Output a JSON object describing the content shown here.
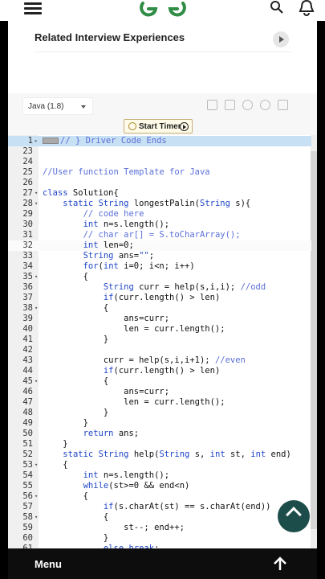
{
  "header": {
    "menu_icon": "hamburger-menu-icon",
    "logo": "geeksforgeeks-logo",
    "search_icon": "search-icon",
    "bell_icon": "notification-bell-icon"
  },
  "related": {
    "title": "Related Interview Experiences",
    "button_icon": "chevron-right-icon"
  },
  "editor": {
    "language": "Java (1.8)",
    "toolbar_icons": [
      "copy-icon",
      "export-icon",
      "settings-icon",
      "reset-icon",
      "fullscreen-icon"
    ],
    "timer_label": "Start Timer",
    "code_lines": [
      {
        "n": "1",
        "fold": "▸",
        "text": "// } Driver Code Ends"
      },
      {
        "n": "23",
        "fold": "",
        "text": ""
      },
      {
        "n": "24",
        "fold": "",
        "text": ""
      },
      {
        "n": "25",
        "fold": "",
        "text": "//User function Template for Java"
      },
      {
        "n": "26",
        "fold": "",
        "text": ""
      },
      {
        "n": "27",
        "fold": "▾",
        "text": "class Solution{"
      },
      {
        "n": "28",
        "fold": "▾",
        "text": "    static String longestPalin(String s){"
      },
      {
        "n": "29",
        "fold": "",
        "text": "        // code here"
      },
      {
        "n": "30",
        "fold": "",
        "text": "        int n=s.length();"
      },
      {
        "n": "31",
        "fold": "",
        "text": "        // char ar[] = S.toCharArray();"
      },
      {
        "n": "32",
        "fold": "",
        "text": "        int len=0;"
      },
      {
        "n": "33",
        "fold": "",
        "text": "        String ans=\"\";"
      },
      {
        "n": "34",
        "fold": "",
        "text": "        for(int i=0; i<n; i++)"
      },
      {
        "n": "35",
        "fold": "▾",
        "text": "        {"
      },
      {
        "n": "36",
        "fold": "",
        "text": "            String curr = help(s,i,i); //odd"
      },
      {
        "n": "37",
        "fold": "",
        "text": "            if(curr.length() > len)"
      },
      {
        "n": "38",
        "fold": "▾",
        "text": "            {"
      },
      {
        "n": "39",
        "fold": "",
        "text": "                ans=curr;"
      },
      {
        "n": "40",
        "fold": "",
        "text": "                len = curr.length();"
      },
      {
        "n": "41",
        "fold": "",
        "text": "            }"
      },
      {
        "n": "42",
        "fold": "",
        "text": ""
      },
      {
        "n": "43",
        "fold": "",
        "text": "            curr = help(s,i,i+1); //even"
      },
      {
        "n": "44",
        "fold": "",
        "text": "            if(curr.length() > len)"
      },
      {
        "n": "45",
        "fold": "▾",
        "text": "            {"
      },
      {
        "n": "46",
        "fold": "",
        "text": "                ans=curr;"
      },
      {
        "n": "47",
        "fold": "",
        "text": "                len = curr.length();"
      },
      {
        "n": "48",
        "fold": "",
        "text": "            }"
      },
      {
        "n": "49",
        "fold": "",
        "text": "        }"
      },
      {
        "n": "50",
        "fold": "",
        "text": "        return ans;"
      },
      {
        "n": "51",
        "fold": "",
        "text": "    }"
      },
      {
        "n": "52",
        "fold": "",
        "text": "    static String help(String s, int st, int end)"
      },
      {
        "n": "53",
        "fold": "▾",
        "text": "    {"
      },
      {
        "n": "54",
        "fold": "",
        "text": "        int n=s.length();"
      },
      {
        "n": "55",
        "fold": "",
        "text": "        while(st>=0 && end<n)"
      },
      {
        "n": "56",
        "fold": "▾",
        "text": "        {"
      },
      {
        "n": "57",
        "fold": "",
        "text": "            if(s.charAt(st) == s.charAt(end))"
      },
      {
        "n": "58",
        "fold": "▾",
        "text": "            {"
      },
      {
        "n": "59",
        "fold": "",
        "text": "                st--; end++;"
      },
      {
        "n": "60",
        "fold": "",
        "text": "            }"
      },
      {
        "n": "61",
        "fold": "",
        "text": "            else break;"
      }
    ]
  },
  "scroll_top_icon": "arrow-up-icon",
  "bottom": {
    "menu_label": "Menu",
    "up_icon": "arrow-up-icon"
  },
  "colors": {
    "accent_green": "#2f8d46",
    "fab_bg": "#1d4d4a",
    "keyword": "#1f46c7",
    "comment": "#5b6fd8",
    "selection": "#c7e0f3"
  }
}
